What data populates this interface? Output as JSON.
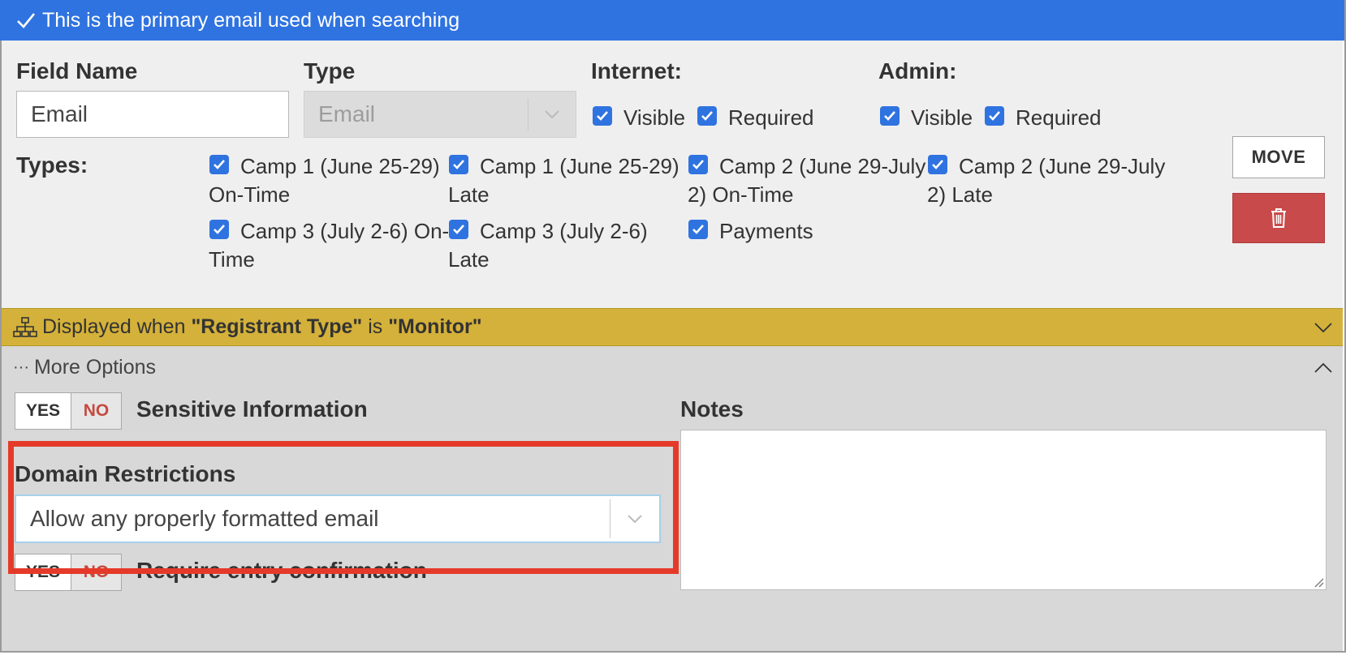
{
  "banner": {
    "text": "This is the primary email used when searching",
    "color": "#2f73e0"
  },
  "field": {
    "field_name_label": "Field Name",
    "field_name_value": "Email",
    "type_label": "Type",
    "type_value": "Email",
    "internet_label": "Internet:",
    "admin_label": "Admin:",
    "visible_label": "Visible",
    "required_label": "Required",
    "types_label": "Types:",
    "types": [
      {
        "line1": "Camp 1 (June 25-29)",
        "line2": "On-Time",
        "checked": true
      },
      {
        "line1": "Camp 1 (June 25-29)",
        "line2": "Late",
        "checked": true
      },
      {
        "line1": "Camp 2 (June 29-July",
        "line2": "2) On-Time",
        "checked": true
      },
      {
        "line1": "Camp 2 (June 29-July",
        "line2": "2) Late",
        "checked": true
      },
      {
        "line1": "Camp 3 (July 2-6) On-",
        "line2": "Time",
        "checked": true
      },
      {
        "line1": "Camp 3 (July 2-6)",
        "line2": "Late",
        "checked": true
      },
      {
        "line1": "Payments",
        "line2": "",
        "checked": true
      }
    ],
    "move_label": "MOVE"
  },
  "condition": {
    "prefix": "Displayed when",
    "field": "\"Registrant Type\"",
    "is": "is",
    "value": "\"Monitor\"",
    "color": "#d4b13a"
  },
  "more": {
    "title": "More Options",
    "sensitive_label": "Sensitive Information",
    "yes": "YES",
    "no": "NO",
    "domain_label": "Domain Restrictions",
    "domain_value": "Allow any properly formatted email",
    "confirm_label": "Require entry confirmation",
    "notes_label": "Notes"
  },
  "colors": {
    "accent": "#2f73e0",
    "danger": "#c94a4a",
    "highlight": "#e53a2a"
  }
}
